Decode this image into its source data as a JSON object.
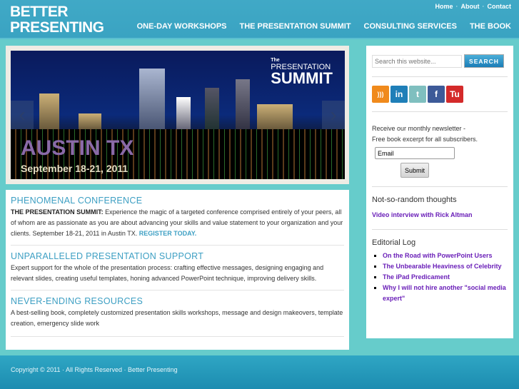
{
  "header": {
    "logo_line1": "BETTER",
    "logo_line2": "PRESENTING",
    "top_links": [
      "Home",
      "About",
      "Contact"
    ],
    "nav": [
      "ONE-DAY WORKSHOPS",
      "THE PRESENTATION SUMMIT",
      "CONSULTING SERVICES",
      "THE BOOK"
    ]
  },
  "banner": {
    "city": "AUSTIN TX",
    "dates": "September 18-21, 2011",
    "logo_the": "The",
    "logo_pres": "PRESENTATION",
    "logo_summit": "SUMMIT"
  },
  "sections": [
    {
      "title": "PHENOMENAL CONFERENCE",
      "lead": "THE PRESENTATION SUMMIT:",
      "body": " Experience the magic of a targeted conference comprised entirely of your peers, all of whom are as passionate as you are about advancing your skills and value statement to your organization and your clients. September 18-21, 2011 in Austin TX. ",
      "link": "REGISTER TODAY."
    },
    {
      "title": "UNPARALLELED PRESENTATION SUPPORT",
      "body": "Expert support for the whole of the presentation process: crafting effective messages, designing engaging and relevant slides, creating useful templates, honing advanced PowerPoint technique, improving delivery skills."
    },
    {
      "title": "NEVER-ENDING RESOURCES",
      "body": "A best-selling book, completely customized presentation skills workshops, message and design makeovers, template creation, emergency slide work"
    }
  ],
  "sidebar": {
    "search_placeholder": "Search this website...",
    "search_button": "SEARCH",
    "social": [
      {
        "name": "rss",
        "label": "",
        "color": "#f08a1c"
      },
      {
        "name": "linkedin",
        "label": "in",
        "color": "#1f7fb8"
      },
      {
        "name": "twitter",
        "label": "t",
        "color": "#7fbfbf"
      },
      {
        "name": "facebook",
        "label": "f",
        "color": "#3d5a98"
      },
      {
        "name": "tumblr",
        "label": "Tu",
        "color": "#d42a2a"
      }
    ],
    "newsletter_line1": "Receive our monthly newsletter -",
    "newsletter_line2": "Free book excerpt for all subscribers.",
    "email_value": "Email",
    "submit": "Submit",
    "thoughts_title": "Not-so-random thoughts",
    "thoughts_link": "Video interview with Rick Altman",
    "log_title": "Editorial Log",
    "log_items": [
      "On the Road with PowerPoint Users",
      "The Unbearable Heaviness of Celebrity",
      "The iPad Predicament",
      "Why I will not hire another \"social media expert\""
    ]
  },
  "footer": {
    "text": "Copyright © 2011 · All Rights Reserved · Better Presenting"
  }
}
